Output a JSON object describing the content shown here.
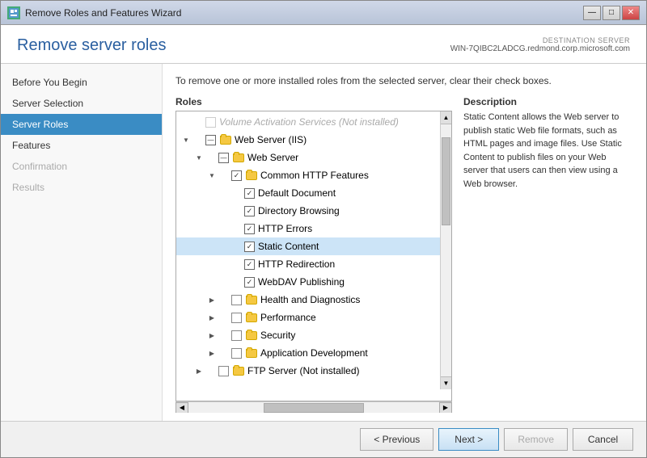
{
  "window": {
    "title": "Remove Roles and Features Wizard",
    "controls": {
      "minimize": "—",
      "maximize": "□",
      "close": "✕"
    }
  },
  "header": {
    "title": "Remove server roles",
    "destination_label": "DESTINATION SERVER",
    "destination_server": "WIN-7QIBC2LADCG.redmond.corp.microsoft.com",
    "description": "To remove one or more installed roles from the selected server, clear their check boxes."
  },
  "sidebar": {
    "items": [
      {
        "label": "Before You Begin",
        "state": "normal"
      },
      {
        "label": "Server Selection",
        "state": "normal"
      },
      {
        "label": "Server Roles",
        "state": "active"
      },
      {
        "label": "Features",
        "state": "normal"
      },
      {
        "label": "Confirmation",
        "state": "disabled"
      },
      {
        "label": "Results",
        "state": "disabled"
      }
    ]
  },
  "roles_panel": {
    "header": "Roles",
    "items": [
      {
        "id": "top-item",
        "label": "Volume Activation Services (Not installed)",
        "indent": 1,
        "checkbox": "none",
        "expanded": false,
        "grayed": true
      },
      {
        "id": "web-server-iis",
        "label": "Web Server (IIS)",
        "indent": 1,
        "checkbox": "partial",
        "expanded": true
      },
      {
        "id": "web-server",
        "label": "Web Server",
        "indent": 2,
        "checkbox": "partial",
        "expanded": true
      },
      {
        "id": "common-http",
        "label": "Common HTTP Features",
        "indent": 3,
        "checkbox": "checked",
        "expanded": true
      },
      {
        "id": "default-document",
        "label": "Default Document",
        "indent": 4,
        "checkbox": "checked",
        "selected": false
      },
      {
        "id": "directory-browsing",
        "label": "Directory Browsing",
        "indent": 4,
        "checkbox": "checked",
        "selected": false
      },
      {
        "id": "http-errors",
        "label": "HTTP Errors",
        "indent": 4,
        "checkbox": "checked",
        "selected": false
      },
      {
        "id": "static-content",
        "label": "Static Content",
        "indent": 4,
        "checkbox": "checked",
        "selected": true
      },
      {
        "id": "http-redirection",
        "label": "HTTP Redirection",
        "indent": 4,
        "checkbox": "checked",
        "selected": false
      },
      {
        "id": "webdav",
        "label": "WebDAV Publishing",
        "indent": 4,
        "checkbox": "checked",
        "selected": false
      },
      {
        "id": "health-diag",
        "label": "Health and Diagnostics",
        "indent": 3,
        "checkbox": "none",
        "expanded": false
      },
      {
        "id": "performance",
        "label": "Performance",
        "indent": 3,
        "checkbox": "none",
        "expanded": false
      },
      {
        "id": "security",
        "label": "Security",
        "indent": 3,
        "checkbox": "none",
        "expanded": false
      },
      {
        "id": "app-dev",
        "label": "Application Development",
        "indent": 3,
        "checkbox": "none",
        "expanded": false
      },
      {
        "id": "ftp",
        "label": "FTP Server (Not installed)",
        "indent": 2,
        "checkbox": "unchecked",
        "expanded": false,
        "grayed": false
      }
    ]
  },
  "description_panel": {
    "header": "Description",
    "text": "Static Content allows the Web server to publish static Web file formats, such as HTML pages and image files. Use Static Content to publish files on your Web server that users can then view using a Web browser."
  },
  "footer": {
    "previous_label": "< Previous",
    "next_label": "Next >",
    "remove_label": "Remove",
    "cancel_label": "Cancel"
  }
}
